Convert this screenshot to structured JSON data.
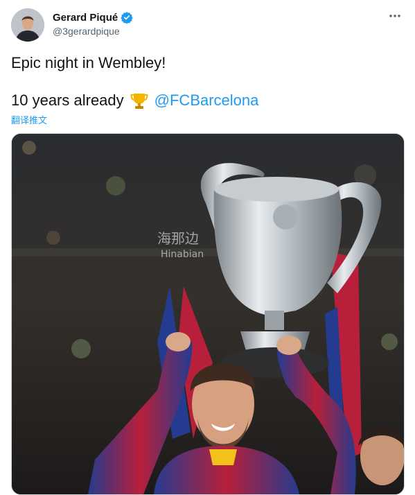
{
  "author": {
    "name": "Gerard Piqué",
    "handle": "@3gerardpique",
    "verified": true
  },
  "tweet": {
    "line1": "Epic night in Wembley!",
    "line2_text": "10 years already",
    "line2_emoji": "trophy-icon",
    "mention": "@FCBarcelona",
    "translate_label": "翻译推文"
  },
  "media": {
    "watermark_cn": "海那边",
    "watermark_en": "Hinabian"
  },
  "colors": {
    "accent": "#1d9bf0",
    "text": "#0f1419",
    "secondary": "#536471"
  }
}
